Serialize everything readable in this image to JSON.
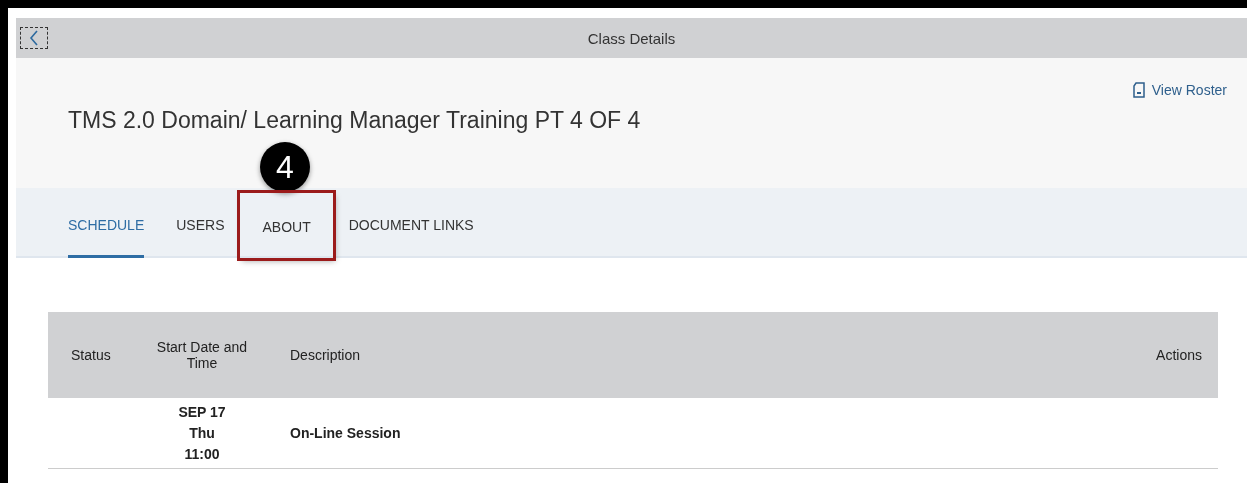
{
  "header": {
    "title": "Class Details"
  },
  "page": {
    "heading": "TMS 2.0 Domain/ Learning Manager Training PT 4 OF 4",
    "roster_link": "View Roster"
  },
  "callout": {
    "label": "4"
  },
  "tabs": [
    {
      "label": "SCHEDULE",
      "selected": true,
      "highlighted": false
    },
    {
      "label": "USERS",
      "selected": false,
      "highlighted": false
    },
    {
      "label": "ABOUT",
      "selected": false,
      "highlighted": true
    },
    {
      "label": "DOCUMENT LINKS",
      "selected": false,
      "highlighted": false
    }
  ],
  "table": {
    "columns": [
      "Status",
      "Start Date and Time",
      "Description",
      "Actions"
    ],
    "rows": [
      {
        "date": "SEP 17",
        "day": "Thu",
        "time": "11:00",
        "description": "On-Line Session"
      }
    ]
  }
}
